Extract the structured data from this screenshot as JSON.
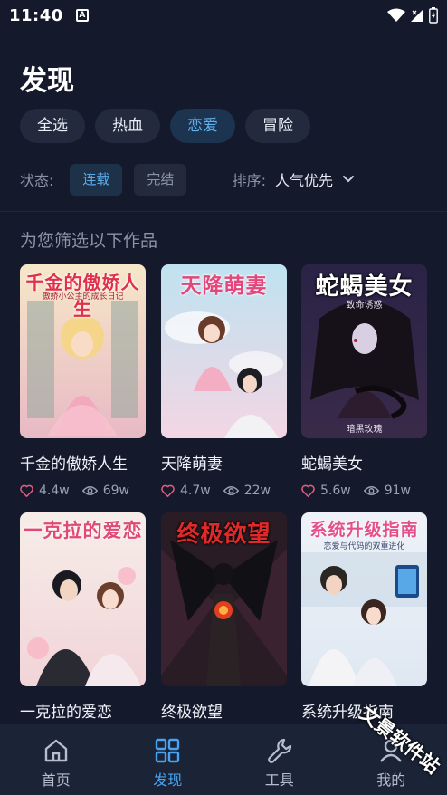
{
  "status_bar": {
    "time": "11:40",
    "notif_letter": "A"
  },
  "page_title": "发现",
  "category_chips": [
    {
      "label": "全选",
      "active": false
    },
    {
      "label": "热血",
      "active": false
    },
    {
      "label": "恋爱",
      "active": true
    },
    {
      "label": "冒险",
      "active": false
    }
  ],
  "filters": {
    "status_label": "状态:",
    "status_options": [
      {
        "label": "连载",
        "active": true
      },
      {
        "label": "完结",
        "active": false
      }
    ],
    "sort_label": "排序:",
    "sort_value": "人气优先"
  },
  "section_title": "为您筛选以下作品",
  "works": [
    {
      "name": "千金的傲娇人生",
      "cover_title": "千金的傲娇人生",
      "cover_subtitle": "傲娇小公主的成长日记",
      "likes": "4.4w",
      "views": "69w"
    },
    {
      "name": "天降萌妻",
      "cover_title": "天降萌妻",
      "cover_subtitle": "",
      "likes": "4.7w",
      "views": "22w"
    },
    {
      "name": "蛇蝎美女",
      "cover_title": "蛇蝎美女",
      "cover_subtitle": "致命诱惑",
      "cover_footer": "暗黑玫瑰",
      "likes": "5.6w",
      "views": "91w"
    },
    {
      "name": "一克拉的爱恋",
      "cover_title": "一克拉的爱恋",
      "cover_subtitle": ""
    },
    {
      "name": "终极欲望",
      "cover_title": "终极欲望",
      "cover_subtitle": ""
    },
    {
      "name": "系统升级指南",
      "cover_title": "系统升级指南",
      "cover_subtitle": "恋爱与代码的双重进化"
    }
  ],
  "bottom_nav": [
    {
      "label": "首页",
      "icon": "home-icon",
      "active": false
    },
    {
      "label": "发现",
      "icon": "grid-icon",
      "active": true
    },
    {
      "label": "工具",
      "icon": "wrench-icon",
      "active": false
    },
    {
      "label": "我的",
      "icon": "user-icon",
      "active": false
    }
  ],
  "watermark": "文景软件站",
  "colors": {
    "accent": "#4aa3f0",
    "background": "#141a2b",
    "chip_bg": "#232a3d",
    "like_icon": "#e0607e"
  }
}
